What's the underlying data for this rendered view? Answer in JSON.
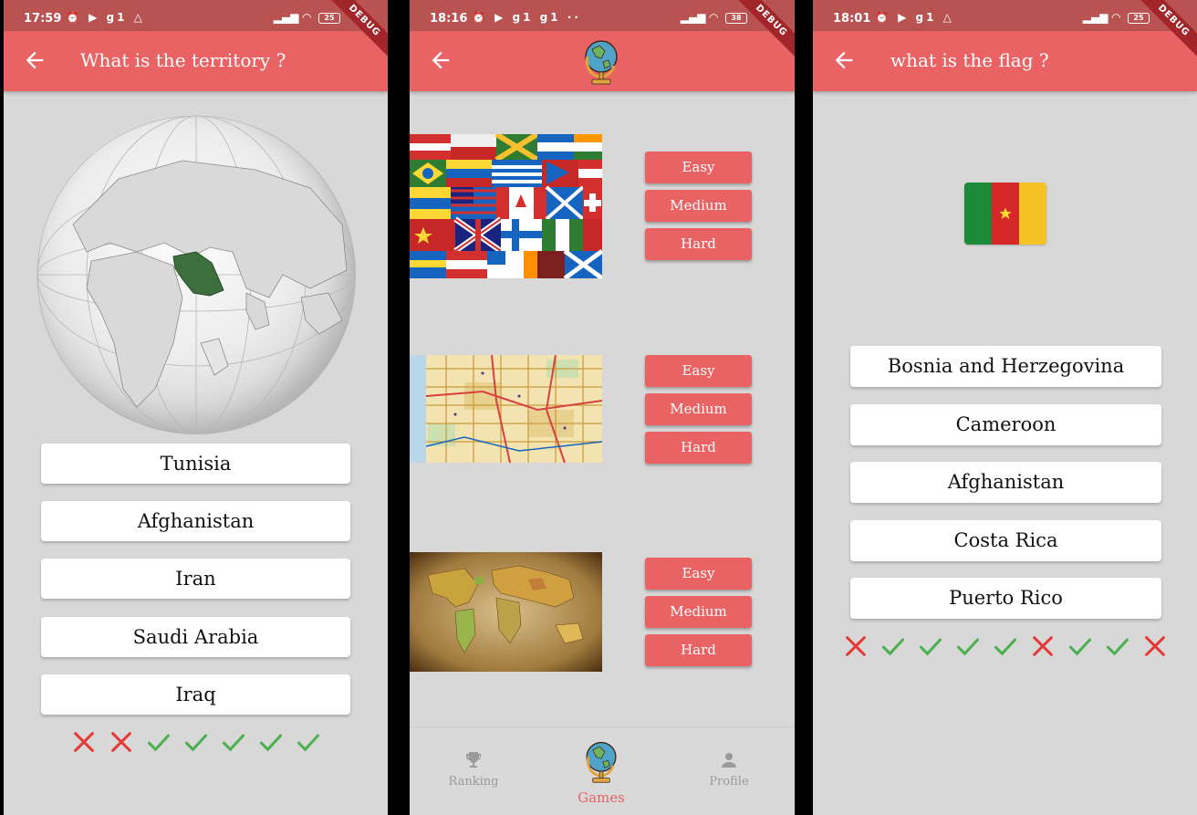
{
  "screens": [
    {
      "status_time": "17:59",
      "status_left_icons": "⏰ ▶ g1 △",
      "battery": "25",
      "debug": "DEBUG",
      "title": "What is the territory ?",
      "answers": [
        "Tunisia",
        "Afghanistan",
        "Iran",
        "Saudi Arabia",
        "Iraq"
      ],
      "results": [
        "wrong",
        "wrong",
        "correct",
        "correct",
        "correct",
        "correct",
        "correct"
      ]
    },
    {
      "status_time": "18:16",
      "status_left_icons": "⏰ ▶ g1 g1 ··",
      "battery": "38",
      "debug": "DEBUG",
      "categories": [
        {
          "image": "world-flags-collage",
          "buttons": [
            "Easy",
            "Medium",
            "Hard"
          ]
        },
        {
          "image": "city-road-map",
          "buttons": [
            "Easy",
            "Medium",
            "Hard"
          ]
        },
        {
          "image": "vintage-world-map",
          "buttons": [
            "Easy",
            "Medium",
            "Hard"
          ]
        }
      ],
      "nav": {
        "ranking": "Ranking",
        "games": "Games",
        "profile": "Profile"
      }
    },
    {
      "status_time": "18:01",
      "status_left_icons": "⏰ ▶ g1 △",
      "battery": "25",
      "debug": "DEBUG",
      "title": "what is the flag ?",
      "flag": "Cameroon flag",
      "answers": [
        "Bosnia and Herzegovina",
        "Cameroon",
        "Afghanistan",
        "Costa Rica",
        "Puerto Rico"
      ],
      "results": [
        "wrong",
        "correct",
        "correct",
        "correct",
        "correct",
        "wrong",
        "correct",
        "correct",
        "wrong"
      ]
    }
  ],
  "colors": {
    "appbar": "#e96364",
    "statusbar": "#b95352",
    "correct": "#4caf50",
    "wrong": "#e53935",
    "background": "#d8d8d8"
  }
}
